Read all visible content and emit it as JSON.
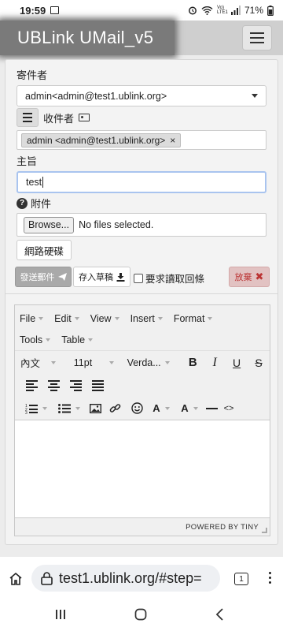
{
  "status_bar": {
    "time": "19:59",
    "battery": "71%",
    "net_label": "Vo) LTE1"
  },
  "header": {
    "title": "UBLink UMail_v5"
  },
  "compose": {
    "sender_label": "寄件者",
    "sender_value": "admin<admin@test1.ublink.org>",
    "recipients_label": "收件者",
    "recipient_tag": "admin <admin@test1.ublink.org>",
    "recipient_remove": "×",
    "subject_label": "主旨",
    "subject_value": "test",
    "attachment_label": "附件",
    "browse_button": "Browse...",
    "no_file_text": "No files selected.",
    "netdisk_button": "網路硬碟",
    "send_button": "發送郵件",
    "draft_button": "存入草稿",
    "read_receipt_label": "要求讀取回條",
    "read_receipt_checked": false,
    "discard_button": "放棄"
  },
  "editor": {
    "menus": [
      "File",
      "Edit",
      "View",
      "Insert",
      "Format",
      "Tools",
      "Table"
    ],
    "format_select": "內文",
    "font_size": "11pt",
    "font_family": "Verda...",
    "bold": "B",
    "italic": "I",
    "underline": "U",
    "strike": "S",
    "font_color_glyph": "A",
    "bg_color_glyph": "A",
    "code_glyph": "<>",
    "powered_by": "POWERED BY TINY"
  },
  "browser": {
    "url": "test1.ublink.org/#step=",
    "tab_count": "1"
  }
}
